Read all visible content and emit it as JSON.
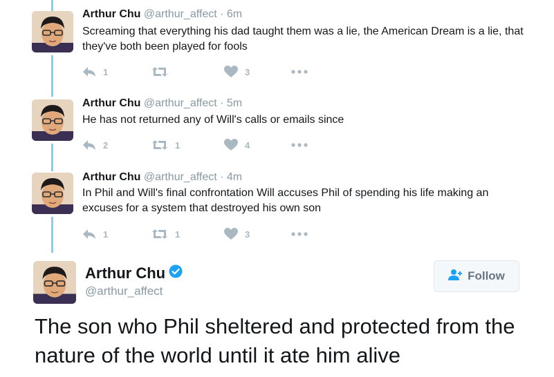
{
  "tweets": [
    {
      "name": "Arthur Chu",
      "handle": "@arthur_affect",
      "time": "· 6m",
      "text": "Screaming that everything his dad taught them was a lie, the American Dream is a lie, that they've both been played for fools",
      "replies": "1",
      "retweets": "",
      "likes": "3"
    },
    {
      "name": "Arthur Chu",
      "handle": "@arthur_affect",
      "time": "· 5m",
      "text": "He has not returned any of Will's calls or emails since",
      "replies": "2",
      "retweets": "1",
      "likes": "4"
    },
    {
      "name": "Arthur Chu",
      "handle": "@arthur_affect",
      "time": "· 4m",
      "text": "In Phil and Will's final confrontation Will accuses Phil of spending his life making an excuses for a system that destroyed his own son",
      "replies": "1",
      "retweets": "1",
      "likes": "3"
    }
  ],
  "main_tweet": {
    "name": "Arthur Chu",
    "handle": "@arthur_affect",
    "follow_label": "Follow",
    "text": "The son who Phil sheltered and protected from the nature of the world until it ate him alive"
  },
  "icons": [
    "reply-icon",
    "retweet-icon",
    "heart-icon",
    "more-icon",
    "verified-icon",
    "follow-user-icon"
  ],
  "colors": {
    "thread_line": "#8ecaeb",
    "meta_gray": "#8899a6",
    "action_gray": "#aab8c2",
    "verified_blue": "#1da1f2"
  }
}
